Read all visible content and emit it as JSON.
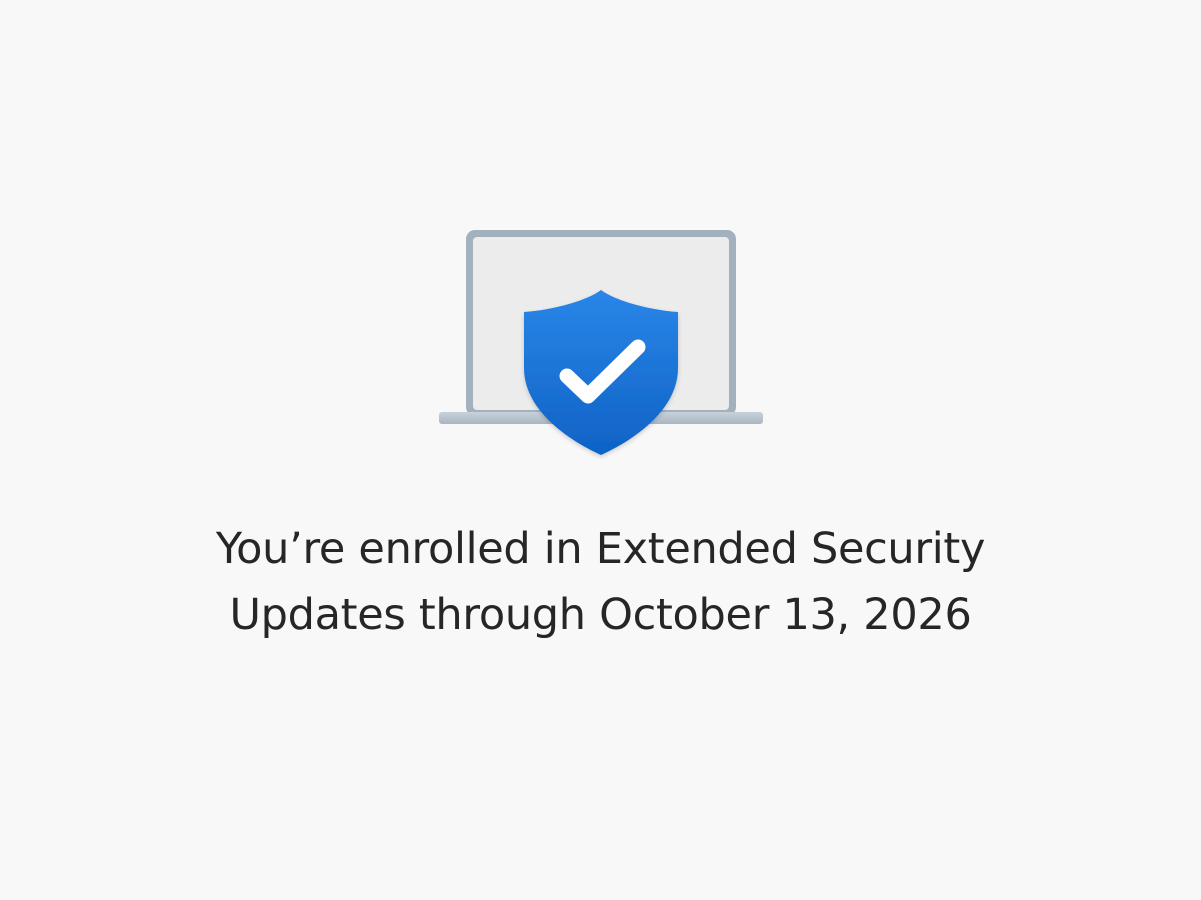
{
  "status": {
    "line1": "You’re enrolled in Extended Security",
    "line2": "Updates through October 13, 2026"
  },
  "illustration": {
    "icons": [
      "laptop-icon",
      "shield-icon",
      "checkmark-icon"
    ],
    "colors": {
      "background": "#f8f8f8",
      "laptop_frame": "#a3b1bf",
      "laptop_screen": "#ececec",
      "shield": "#1a73d9",
      "checkmark": "#ffffff",
      "text": "#262626"
    }
  }
}
